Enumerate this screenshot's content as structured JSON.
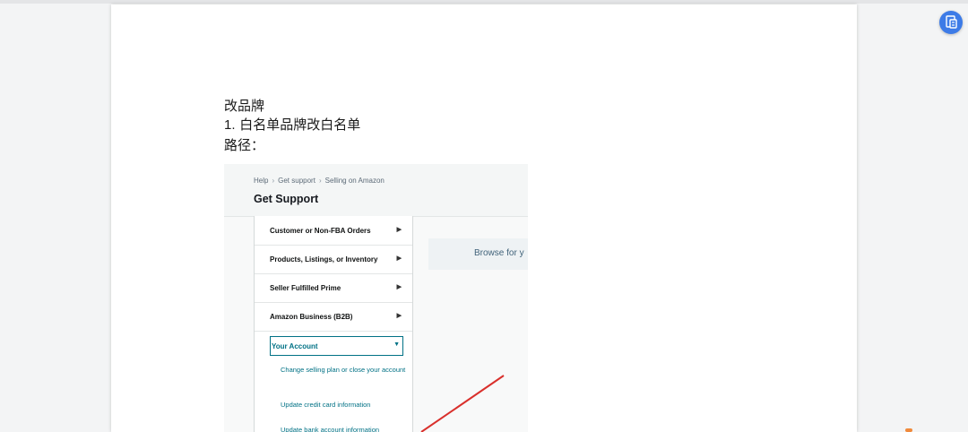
{
  "document": {
    "lines": [
      "改品牌",
      "1.",
      "白名单品牌改白名单",
      "路径："
    ]
  },
  "embedded_screenshot": {
    "breadcrumb": [
      "Help",
      "Get support",
      "Selling on Amazon"
    ],
    "title": "Get Support",
    "menu": [
      {
        "label": "Customer or Non-FBA Orders",
        "arrow": "▶"
      },
      {
        "label": "Products, Listings, or Inventory",
        "arrow": "▶"
      },
      {
        "label": "Seller Fulfilled Prime",
        "arrow": "▶"
      },
      {
        "label": "Amazon Business (B2B)",
        "arrow": "▶"
      }
    ],
    "selected": {
      "label": "Your Account",
      "arrow": "▼"
    },
    "submenu": [
      "Change selling plan or close your account",
      "Update credit card information",
      "Update bank account information"
    ],
    "browse_text": "Browse for y",
    "annotation_color": "#d9302c"
  },
  "fab": {
    "icon": "document-convert-icon",
    "color": "#3d7be7"
  }
}
